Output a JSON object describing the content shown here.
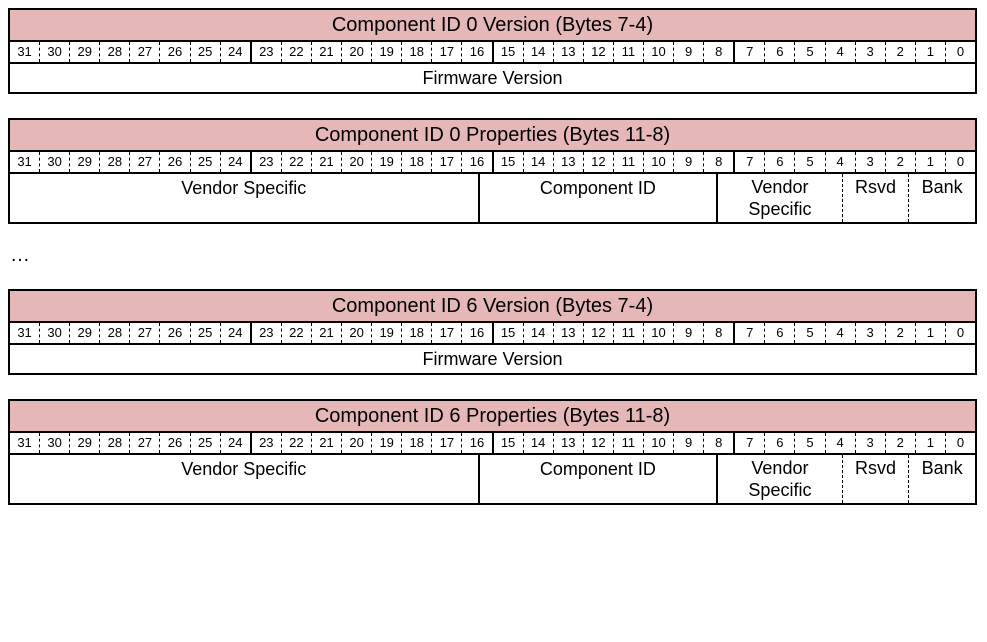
{
  "bits": [
    "31",
    "30",
    "29",
    "28",
    "27",
    "26",
    "25",
    "24",
    "23",
    "22",
    "21",
    "20",
    "19",
    "18",
    "17",
    "16",
    "15",
    "14",
    "13",
    "12",
    "11",
    "10",
    "9",
    "8",
    "7",
    "6",
    "5",
    "4",
    "3",
    "2",
    "1",
    "0"
  ],
  "ellipsis": "…",
  "regs": [
    {
      "title": "Component ID 0 Version (Bytes 7-4)",
      "fields": [
        {
          "w": 32,
          "label": "Firmware Version",
          "cls": "single field"
        }
      ]
    },
    {
      "title": "Component ID 0 Properties (Bytes 11-8)",
      "fields": [
        {
          "w": 16,
          "label": "Vendor Specific",
          "cls": "single field"
        },
        {
          "w": 8,
          "label": "Component ID",
          "cls": "single field"
        },
        {
          "w": 4,
          "label": "Vendor\nSpecific",
          "cls": "multi field"
        },
        {
          "w": 2,
          "label": "Rsvd",
          "cls": "multi subfield"
        },
        {
          "w": 2,
          "label": "Bank",
          "cls": "multi subfield"
        }
      ]
    },
    null,
    {
      "title": "Component ID 6 Version (Bytes 7-4)",
      "fields": [
        {
          "w": 32,
          "label": "Firmware Version",
          "cls": "single field"
        }
      ]
    },
    {
      "title": "Component ID 6 Properties (Bytes 11-8)",
      "fields": [
        {
          "w": 16,
          "label": "Vendor Specific",
          "cls": "single field"
        },
        {
          "w": 8,
          "label": "Component ID",
          "cls": "single field"
        },
        {
          "w": 4,
          "label": "Vendor\nSpecific",
          "cls": "multi field"
        },
        {
          "w": 2,
          "label": "Rsvd",
          "cls": "multi subfield"
        },
        {
          "w": 2,
          "label": "Bank",
          "cls": "multi subfield"
        }
      ]
    }
  ]
}
